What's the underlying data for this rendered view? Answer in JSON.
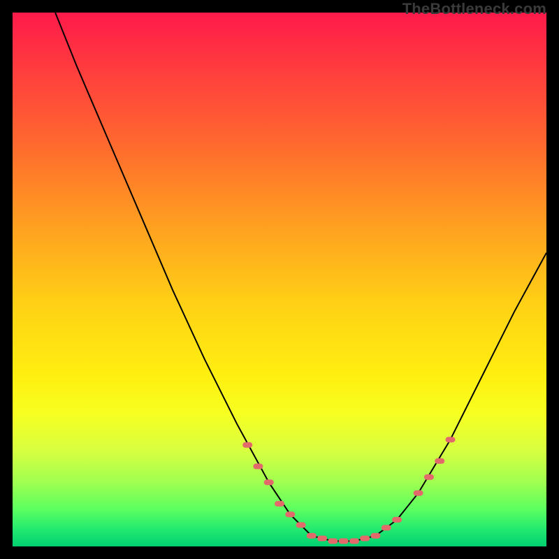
{
  "watermark": "TheBottleneck.com",
  "chart_data": {
    "type": "line",
    "title": "",
    "xlabel": "",
    "ylabel": "",
    "xlim": [
      0,
      100
    ],
    "ylim": [
      0,
      100
    ],
    "series": [
      {
        "name": "curve",
        "color": "#000000",
        "points": [
          {
            "x": 8,
            "y": 100
          },
          {
            "x": 12,
            "y": 90
          },
          {
            "x": 18,
            "y": 76
          },
          {
            "x": 24,
            "y": 62
          },
          {
            "x": 30,
            "y": 48
          },
          {
            "x": 36,
            "y": 35
          },
          {
            "x": 42,
            "y": 23
          },
          {
            "x": 48,
            "y": 12
          },
          {
            "x": 52,
            "y": 6
          },
          {
            "x": 56,
            "y": 2
          },
          {
            "x": 60,
            "y": 1
          },
          {
            "x": 64,
            "y": 1
          },
          {
            "x": 68,
            "y": 2
          },
          {
            "x": 72,
            "y": 5
          },
          {
            "x": 76,
            "y": 10
          },
          {
            "x": 82,
            "y": 20
          },
          {
            "x": 88,
            "y": 32
          },
          {
            "x": 94,
            "y": 44
          },
          {
            "x": 100,
            "y": 55
          }
        ]
      }
    ],
    "markers": {
      "name": "dotted-segments",
      "color": "#e36a6a",
      "points": [
        {
          "x": 44,
          "y": 19
        },
        {
          "x": 46,
          "y": 15
        },
        {
          "x": 48,
          "y": 12
        },
        {
          "x": 50,
          "y": 8
        },
        {
          "x": 52,
          "y": 6
        },
        {
          "x": 54,
          "y": 4
        },
        {
          "x": 56,
          "y": 2
        },
        {
          "x": 58,
          "y": 1.5
        },
        {
          "x": 60,
          "y": 1
        },
        {
          "x": 62,
          "y": 1
        },
        {
          "x": 64,
          "y": 1
        },
        {
          "x": 66,
          "y": 1.5
        },
        {
          "x": 68,
          "y": 2
        },
        {
          "x": 70,
          "y": 3.5
        },
        {
          "x": 72,
          "y": 5
        },
        {
          "x": 76,
          "y": 10
        },
        {
          "x": 78,
          "y": 13
        },
        {
          "x": 80,
          "y": 16
        },
        {
          "x": 82,
          "y": 20
        }
      ]
    }
  }
}
